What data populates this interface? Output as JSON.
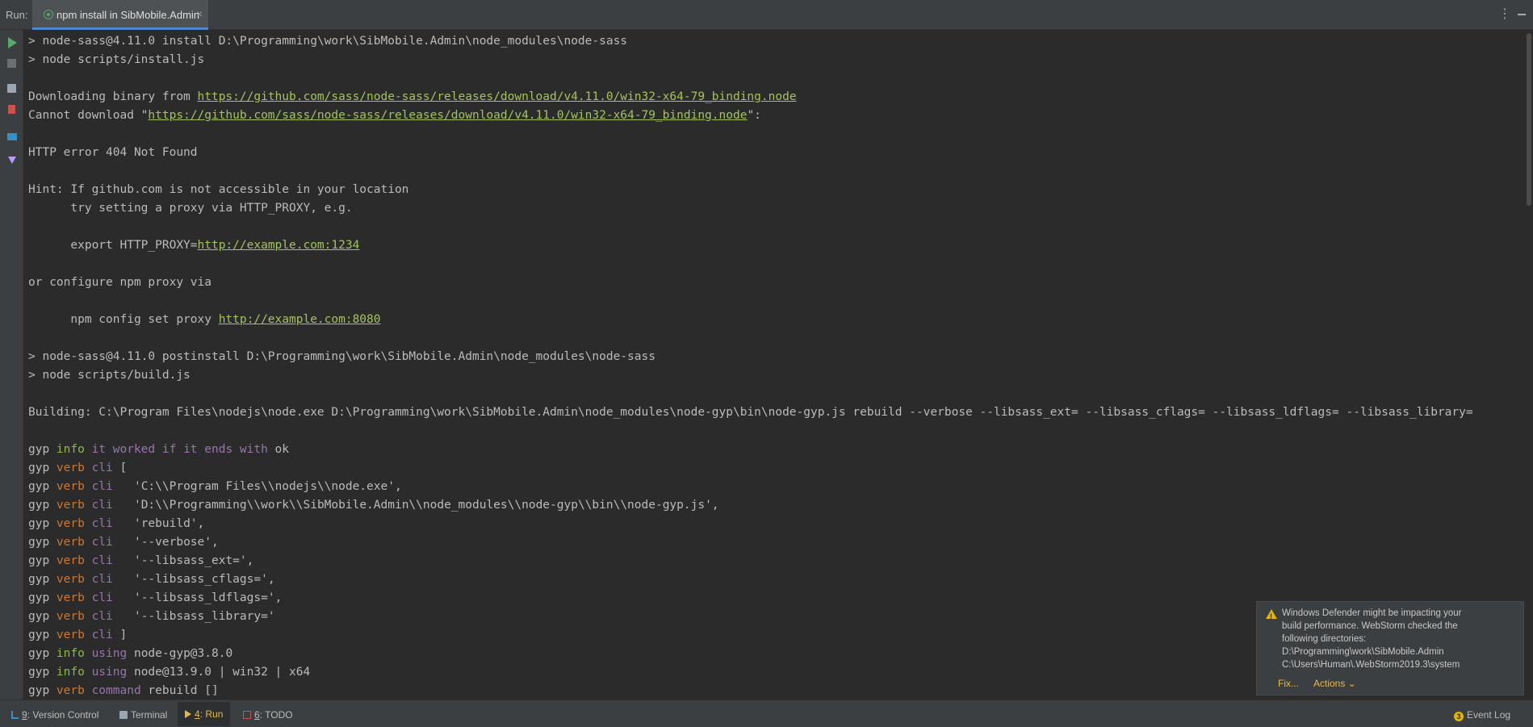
{
  "tabbar": {
    "run_label": "Run:",
    "tab_label": "npm install in SibMobile.Admin",
    "close_symbol": "×",
    "more_symbol": "⋮"
  },
  "toolbar": {
    "icons": [
      "rerun-icon",
      "stop-icon",
      "scroll-to-end-icon",
      "clear-all-icon",
      "layout-icon",
      "pin-icon"
    ]
  },
  "console": {
    "lines": [
      {
        "type": "plain",
        "text": "> node-sass@4.11.0 install D:\\Programming\\work\\SibMobile.Admin\\node_modules\\node-sass"
      },
      {
        "type": "plain",
        "text": "> node scripts/install.js"
      },
      {
        "type": "plain",
        "text": ""
      },
      {
        "type": "url",
        "prefix": "Downloading binary from ",
        "url": "https://github.com/sass/node-sass/releases/download/v4.11.0/win32-x64-79_binding.node",
        "suffix": ""
      },
      {
        "type": "url",
        "prefix": "Cannot download \"",
        "url": "https://github.com/sass/node-sass/releases/download/v4.11.0/win32-x64-79_binding.node",
        "suffix": "\":"
      },
      {
        "type": "plain",
        "text": ""
      },
      {
        "type": "plain",
        "text": "HTTP error 404 Not Found"
      },
      {
        "type": "plain",
        "text": ""
      },
      {
        "type": "plain",
        "text": "Hint: If github.com is not accessible in your location"
      },
      {
        "type": "plain",
        "text": "      try setting a proxy via HTTP_PROXY, e.g."
      },
      {
        "type": "plain",
        "text": ""
      },
      {
        "type": "url",
        "prefix": "      export HTTP_PROXY=",
        "url": "http://example.com:1234",
        "suffix": ""
      },
      {
        "type": "plain",
        "text": ""
      },
      {
        "type": "plain",
        "text": "or configure npm proxy via"
      },
      {
        "type": "plain",
        "text": ""
      },
      {
        "type": "url",
        "prefix": "      npm config set proxy ",
        "url": "http://example.com:8080",
        "suffix": ""
      },
      {
        "type": "plain",
        "text": ""
      },
      {
        "type": "plain",
        "text": "> node-sass@4.11.0 postinstall D:\\Programming\\work\\SibMobile.Admin\\node_modules\\node-sass"
      },
      {
        "type": "plain",
        "text": "> node scripts/build.js"
      },
      {
        "type": "plain",
        "text": ""
      },
      {
        "type": "plain",
        "text": "Building: C:\\Program Files\\nodejs\\node.exe D:\\Programming\\work\\SibMobile.Admin\\node_modules\\node-gyp\\bin\\node-gyp.js rebuild --verbose --libsass_ext= --libsass_cflags= --libsass_ldflags= --libsass_library="
      },
      {
        "type": "plain",
        "text": ""
      },
      {
        "type": "gyp",
        "level": "info",
        "key": "it worked if it ends with",
        "rest": " ok"
      },
      {
        "type": "gyp",
        "level": "verb",
        "key": "cli",
        "rest": " ["
      },
      {
        "type": "gyp",
        "level": "verb",
        "key": "cli",
        "rest": "   'C:\\\\Program Files\\\\nodejs\\\\node.exe',"
      },
      {
        "type": "gyp",
        "level": "verb",
        "key": "cli",
        "rest": "   'D:\\\\Programming\\\\work\\\\SibMobile.Admin\\\\node_modules\\\\node-gyp\\\\bin\\\\node-gyp.js',"
      },
      {
        "type": "gyp",
        "level": "verb",
        "key": "cli",
        "rest": "   'rebuild',"
      },
      {
        "type": "gyp",
        "level": "verb",
        "key": "cli",
        "rest": "   '--verbose',"
      },
      {
        "type": "gyp",
        "level": "verb",
        "key": "cli",
        "rest": "   '--libsass_ext=',"
      },
      {
        "type": "gyp",
        "level": "verb",
        "key": "cli",
        "rest": "   '--libsass_cflags=',"
      },
      {
        "type": "gyp",
        "level": "verb",
        "key": "cli",
        "rest": "   '--libsass_ldflags=',"
      },
      {
        "type": "gyp",
        "level": "verb",
        "key": "cli",
        "rest": "   '--libsass_library='"
      },
      {
        "type": "gyp",
        "level": "verb",
        "key": "cli",
        "rest": " ]"
      },
      {
        "type": "gyp",
        "level": "info",
        "key": "using",
        "rest": " node-gyp@3.8.0"
      },
      {
        "type": "gyp",
        "level": "info",
        "key": "using",
        "rest": " node@13.9.0 | win32 | x64"
      },
      {
        "type": "gyp",
        "level": "verb",
        "key": "command",
        "rest": " rebuild []"
      }
    ]
  },
  "notification": {
    "text": "Windows Defender might be impacting your\nbuild performance. WebStorm checked the\nfollowing directories:\nD:\\Programming\\work\\SibMobile.Admin\nC:\\Users\\Human\\.WebStorm2019.3\\system",
    "fix_label": "Fix...",
    "actions_label": "Actions ⌄"
  },
  "statusbar": {
    "version_control": {
      "key": "9",
      "label": ": Version Control"
    },
    "terminal": "Terminal",
    "run": {
      "key": "4",
      "label": ": Run"
    },
    "todo": {
      "key": "6",
      "label": ": TODO"
    },
    "event_log": "Event Log"
  },
  "colors": {
    "background": "#2b2b2b",
    "url": "#a5c25c",
    "gyp_info": "#8fb94a",
    "gyp_verb": "#cc7832",
    "gyp_key": "#9876aa"
  }
}
